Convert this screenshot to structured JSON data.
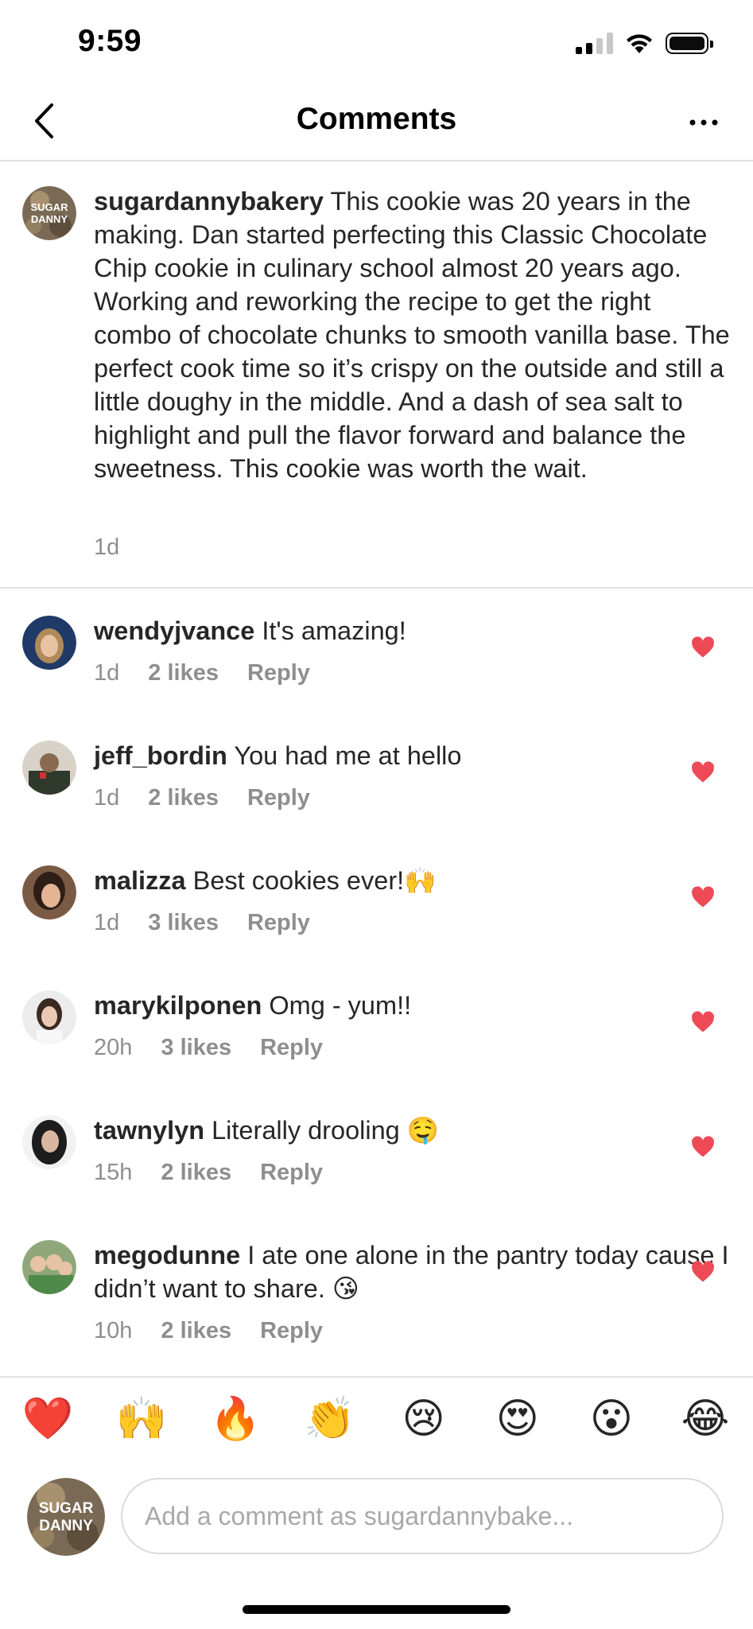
{
  "status": {
    "time": "9:59"
  },
  "header": {
    "title": "Comments"
  },
  "caption": {
    "username": "sugardannybakery",
    "text": "This cookie was 20 years in the making. Dan started perfecting this Classic Chocolate Chip cookie in culinary school almost 20 years ago. Working and reworking the recipe to get the right combo of chocolate chunks to smooth vanilla base. The perfect cook time so it’s crispy on the outside and still a little doughy in the middle. And a dash of sea salt to highlight and pull the flavor forward and balance the sweetness. This cookie was worth the wait.",
    "time": "1d",
    "avatar_text": [
      "SUGAR",
      "DANNY"
    ]
  },
  "comments": [
    {
      "username": "wendyjvance",
      "text": "It's amazing!",
      "time": "1d",
      "likes": "2 likes",
      "reply": "Reply"
    },
    {
      "username": "jeff_bordin",
      "text": "You had me at hello",
      "time": "1d",
      "likes": "2 likes",
      "reply": "Reply"
    },
    {
      "username": "malizza",
      "text": "Best cookies ever!🙌",
      "time": "1d",
      "likes": "3 likes",
      "reply": "Reply"
    },
    {
      "username": "marykilponen",
      "text": "Omg - yum!!",
      "time": "20h",
      "likes": "3 likes",
      "reply": "Reply"
    },
    {
      "username": "tawnylyn",
      "text": "Literally drooling 🤤",
      "time": "15h",
      "likes": "2 likes",
      "reply": "Reply"
    },
    {
      "username": "megodunne",
      "text": "I ate one alone in the pantry today cause I didn’t want to share. 😘",
      "time": "10h",
      "likes": "2 likes",
      "reply": "Reply"
    }
  ],
  "emoji_bar": [
    "❤️",
    "🙌",
    "🔥",
    "👏",
    "😢",
    "😍",
    "😮",
    "😂"
  ],
  "composer": {
    "placeholder": "Add a comment as sugardannybake..."
  },
  "colors": {
    "heart": "#ed4956",
    "meta": "#8e8e8e",
    "divider": "#e2e2e2"
  }
}
